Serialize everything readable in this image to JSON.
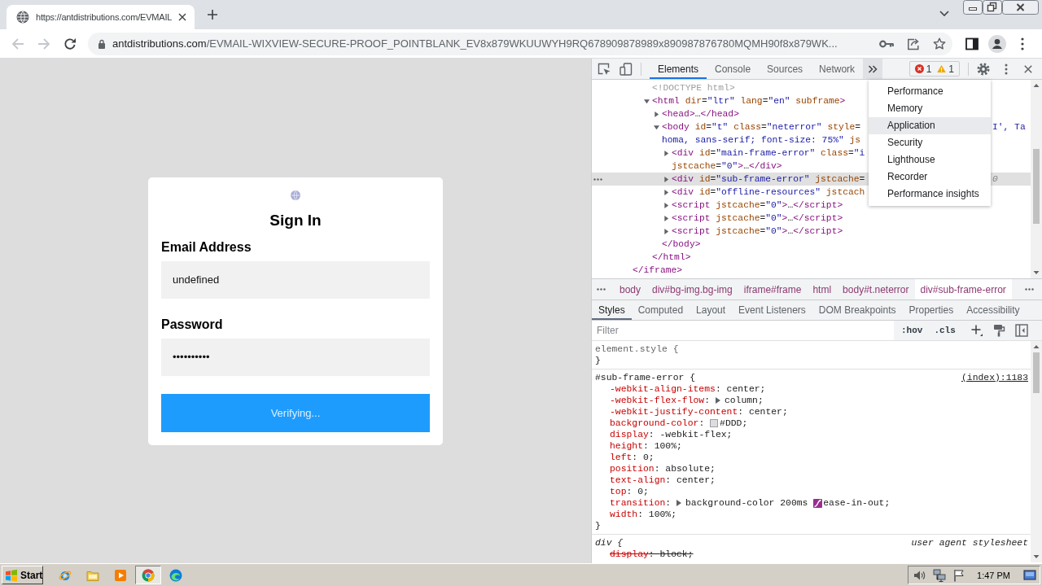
{
  "browser": {
    "tabs": [
      {
        "title": "https://antdistributions.com/EVMAIL",
        "selected": true
      }
    ],
    "nav": {
      "back_disabled": true,
      "forward_disabled": true
    },
    "address": {
      "host": "antdistributions.com",
      "path": "/EVMAIL-WIXVIEW-SECURE-PROOF_POINTBLANK_EV8x879WKUUWYH9RQ678909878989x890987876780MQMH90f8x879WK..."
    },
    "bookmarked": false
  },
  "page": {
    "title": "Sign In",
    "fields": [
      {
        "label": "Email Address",
        "value": "undefined"
      },
      {
        "label": "Password",
        "value": "••••••••••"
      }
    ],
    "button": "Verifying..."
  },
  "devtools": {
    "tabs": [
      {
        "label": "Elements",
        "selected": true
      },
      {
        "label": "Console",
        "selected": false
      },
      {
        "label": "Sources",
        "selected": false
      },
      {
        "label": "Network",
        "selected": false
      }
    ],
    "more_tabs": {
      "expanded": true,
      "items": [
        {
          "label": "Performance",
          "selected": false
        },
        {
          "label": "Memory",
          "selected": false
        },
        {
          "label": "Application",
          "selected": true
        },
        {
          "label": "Security",
          "selected": false
        },
        {
          "label": "Lighthouse",
          "selected": false
        },
        {
          "label": "Recorder",
          "selected": false
        },
        {
          "label": "Performance insights",
          "selected": false
        }
      ]
    },
    "issues": {
      "errors": "1",
      "warnings": "1"
    },
    "dom_tree": [
      {
        "close": "</iframe>",
        "children": [
          {
            "kind": "doctype",
            "text": "<!DOCTYPE html>",
            "selected": false
          },
          {
            "kind": "element",
            "text": "<html dir=\"ltr\" lang=\"en\" subframe>",
            "expanded": true,
            "selected": false,
            "close": "</html>",
            "children": [
              {
                "kind": "element",
                "text": "<head>…</head>",
                "expanded": false,
                "selected": false
              },
              {
                "kind": "element",
                "text": "<body id=\"t\" class=\"neterror\" style=",
                "right": {
                  "text": "I', Ta",
                  "kind": "value"
                },
                "wrap": "homa, sans-serif; font-size: 75%\" js",
                "expanded": true,
                "selected": false,
                "close": "</body>",
                "children": [
                  {
                    "kind": "element",
                    "text": "<div id=\"main-frame-error\" class=\"i",
                    "wrap": "jstcache=\"0\">…</div>",
                    "expanded": false,
                    "selected": false
                  },
                  {
                    "kind": "element",
                    "text": "<div id=\"sub-frame-error\" jstcache=",
                    "right": {
                      "text": "0",
                      "kind": "hint"
                    },
                    "expanded": false,
                    "selected": true
                  },
                  {
                    "kind": "element",
                    "text": "<div id=\"offline-resources\" jstcach",
                    "expanded": false,
                    "selected": false
                  },
                  {
                    "kind": "element",
                    "text": "<script jstcache=\"0\">…</script>",
                    "expanded": false,
                    "selected": false
                  },
                  {
                    "kind": "element",
                    "text": "<script jstcache=\"0\">…</script>",
                    "expanded": false,
                    "selected": false
                  },
                  {
                    "kind": "element",
                    "text": "<script jstcache=\"0\">…</script>",
                    "expanded": false,
                    "selected": false
                  }
                ]
              }
            ]
          }
        ]
      }
    ],
    "breadcrumbs": [
      {
        "label": "body",
        "selected": false
      },
      {
        "label": "div#bg-img.bg-img",
        "selected": false
      },
      {
        "label": "iframe#frame",
        "selected": false
      },
      {
        "label": "html",
        "selected": false
      },
      {
        "label": "body#t.neterror",
        "selected": false
      },
      {
        "label": "div#sub-frame-error",
        "selected": true
      }
    ],
    "pane_tabs": [
      {
        "label": "Styles",
        "selected": true
      },
      {
        "label": "Computed",
        "selected": false
      },
      {
        "label": "Layout",
        "selected": false
      },
      {
        "label": "Event Listeners",
        "selected": false
      },
      {
        "label": "DOM Breakpoints",
        "selected": false
      },
      {
        "label": "Properties",
        "selected": false
      },
      {
        "label": "Accessibility",
        "selected": false
      }
    ],
    "filter": {
      "placeholder": "Filter"
    },
    "style_toggles": [
      ":hov",
      ".cls"
    ],
    "rules": [
      {
        "kind": "inline",
        "selector": "element.style {",
        "closing": "}"
      },
      {
        "kind": "author",
        "selector": "#sub-frame-error {",
        "source": "(index):1183",
        "closing": "}",
        "declarations": [
          {
            "text": "-webkit-align-items: center;",
            "expandable": false,
            "easing": false,
            "overridden": false
          },
          {
            "text": "-webkit-flex-flow: column;",
            "expandable": true,
            "easing": false,
            "overridden": false
          },
          {
            "text": "-webkit-justify-content: center;",
            "expandable": false,
            "easing": false,
            "overridden": false
          },
          {
            "text": "background-color: #DDD;",
            "color": "#dddddd",
            "expandable": false,
            "easing": false,
            "overridden": false
          },
          {
            "text": "display: -webkit-flex;",
            "expandable": false,
            "easing": false,
            "overridden": false
          },
          {
            "text": "height: 100%;",
            "expandable": false,
            "easing": false,
            "overridden": false
          },
          {
            "text": "left: 0;",
            "expandable": false,
            "easing": false,
            "overridden": false
          },
          {
            "text": "position: absolute;",
            "expandable": false,
            "easing": false,
            "overridden": false
          },
          {
            "text": "text-align: center;",
            "expandable": false,
            "easing": false,
            "overridden": false
          },
          {
            "text": "top: 0;",
            "expandable": false,
            "easing": false,
            "overridden": false
          },
          {
            "text": "transition: background-color 200ms ease-in-out;",
            "expandable": true,
            "easing": true,
            "overridden": false
          },
          {
            "text": "width: 100%;",
            "expandable": false,
            "easing": false,
            "overridden": false
          }
        ]
      },
      {
        "kind": "user-agent",
        "selector": "div {",
        "source": "user agent stylesheet",
        "declarations": [
          {
            "text": "display: block;",
            "expandable": false,
            "easing": false,
            "overridden": true
          }
        ]
      }
    ]
  },
  "taskbar": {
    "start": "Start",
    "apps": [
      {
        "kind": "orbit",
        "selected": false
      },
      {
        "kind": "folder",
        "selected": false
      },
      {
        "kind": "player",
        "selected": false
      },
      {
        "kind": "ring",
        "selected": true
      },
      {
        "kind": "wave",
        "selected": false
      }
    ],
    "tray": [
      {
        "kind": "speaker"
      },
      {
        "kind": "network"
      },
      {
        "kind": "flag"
      }
    ],
    "clock": "1:47 PM"
  }
}
